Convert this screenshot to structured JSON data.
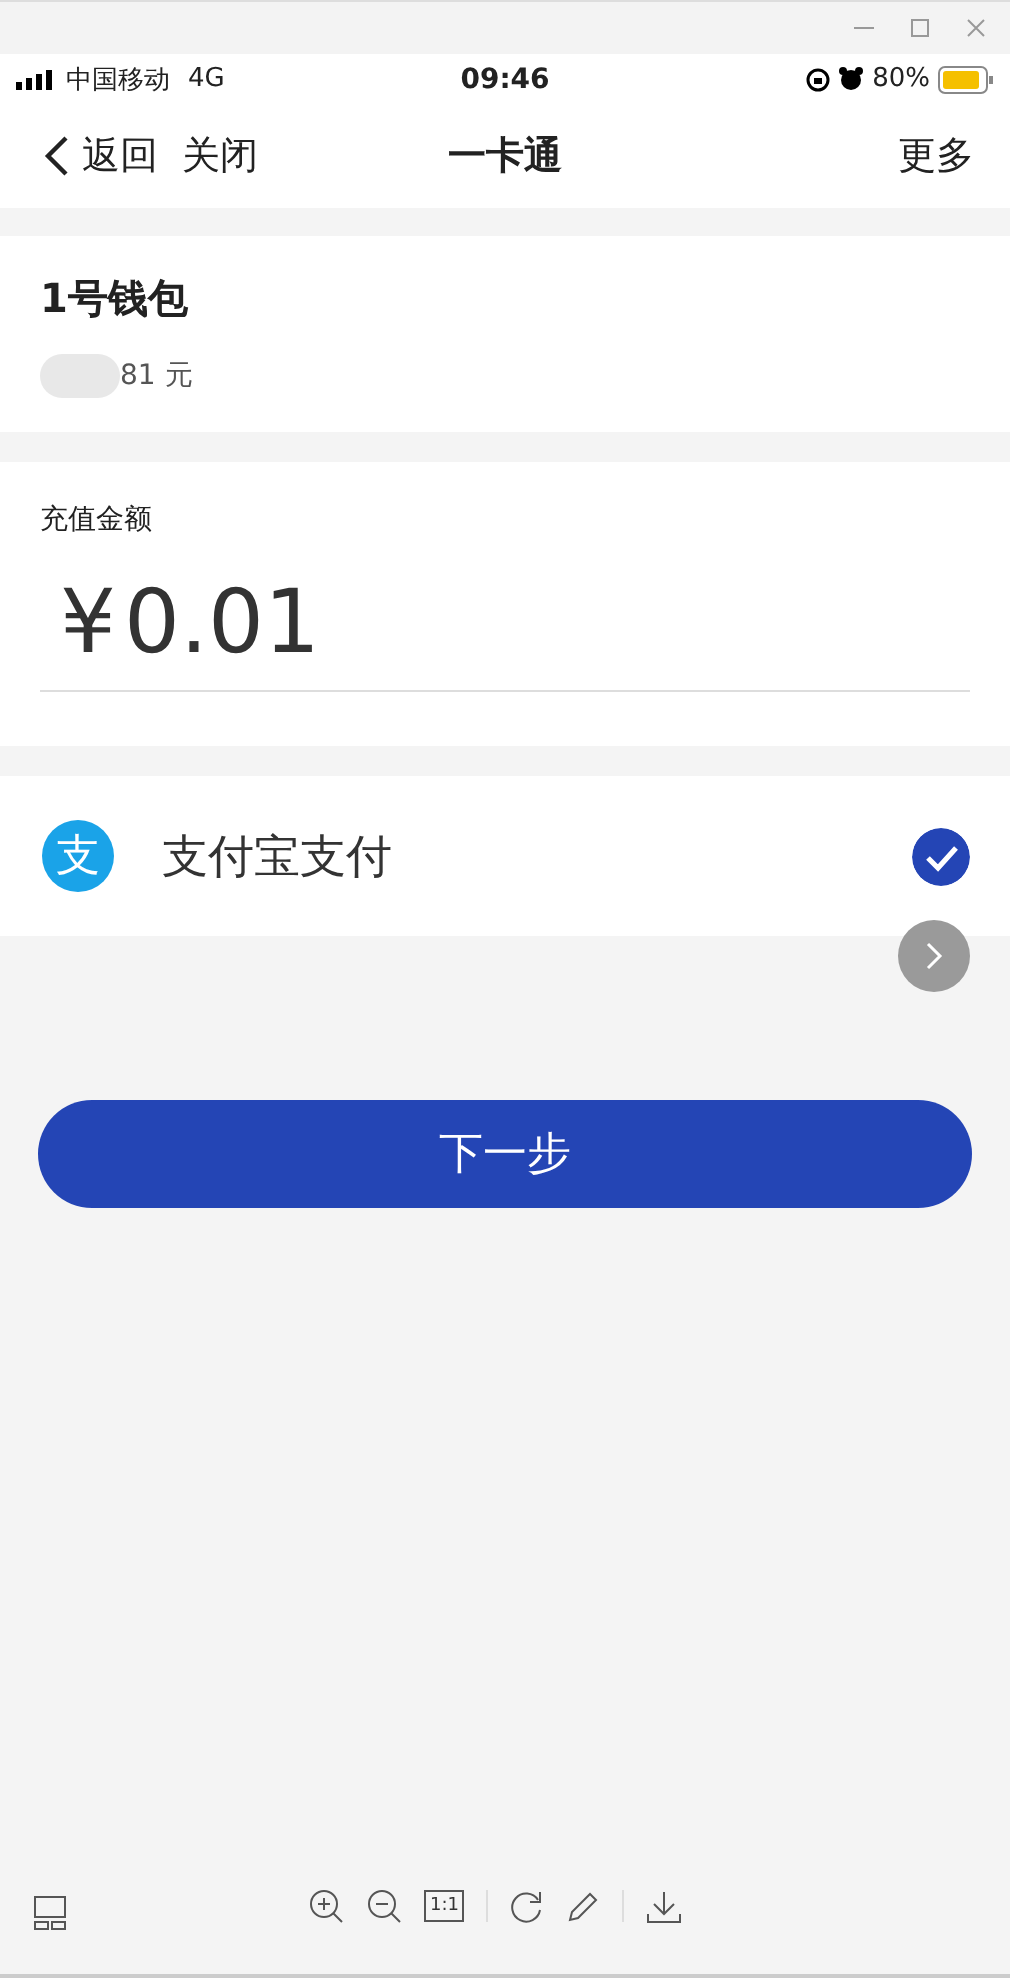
{
  "status_bar": {
    "carrier": "中国移动",
    "network": "4G",
    "time": "09:46",
    "battery": "80%"
  },
  "nav": {
    "back": "返回",
    "close": "关闭",
    "title": "一卡通",
    "more": "更多"
  },
  "wallet": {
    "name": "1号钱包",
    "balance": "81 元"
  },
  "amount": {
    "label": "充值金额",
    "currency": "¥",
    "value": "0.01"
  },
  "payment_methods": [
    {
      "logo": "支",
      "name": "支付宝支付",
      "selected": true
    }
  ],
  "next_button": "下一步",
  "viewer_toolbar": {
    "actual_size": "1:1"
  }
}
